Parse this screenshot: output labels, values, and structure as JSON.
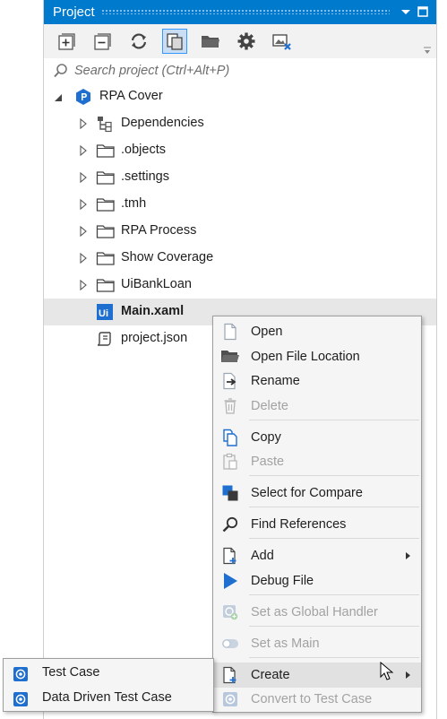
{
  "panel": {
    "title": "Project",
    "accent": "#007acc",
    "controls": [
      "chevron-down-icon",
      "restore-icon"
    ]
  },
  "toolbar": {
    "buttons": [
      {
        "name": "expand-all-icon"
      },
      {
        "name": "collapse-all-icon"
      },
      {
        "name": "refresh-icon"
      },
      {
        "name": "show-all-files-icon",
        "active": true
      },
      {
        "name": "open-folder-icon"
      },
      {
        "name": "settings-icon"
      },
      {
        "name": "remove-unused-icon"
      }
    ]
  },
  "search": {
    "placeholder": "Search project (Ctrl+Alt+P)",
    "value": ""
  },
  "tree": {
    "root": {
      "label": "RPA Cover",
      "icon": "project-icon",
      "expanded": true
    },
    "children": [
      {
        "label": "Dependencies",
        "icon": "dependencies-icon",
        "expandable": true
      },
      {
        "label": ".objects",
        "icon": "folder-icon",
        "expandable": true
      },
      {
        "label": ".settings",
        "icon": "folder-icon",
        "expandable": true
      },
      {
        "label": ".tmh",
        "icon": "folder-icon",
        "expandable": true
      },
      {
        "label": "RPA Process",
        "icon": "folder-icon",
        "expandable": true
      },
      {
        "label": "Show Coverage",
        "icon": "folder-icon",
        "expandable": true
      },
      {
        "label": "UiBankLoan",
        "icon": "folder-icon",
        "expandable": true
      },
      {
        "label": "Main.xaml",
        "icon": "xaml-file-icon",
        "selected": true
      },
      {
        "label": "project.json",
        "icon": "json-file-icon"
      }
    ]
  },
  "context_menu": {
    "items": [
      {
        "label": "Open",
        "icon": "file-icon"
      },
      {
        "label": "Open File Location",
        "icon": "folder-open-icon"
      },
      {
        "label": "Rename",
        "icon": "rename-icon"
      },
      {
        "label": "Delete",
        "icon": "trash-icon",
        "disabled": true
      },
      {
        "label": "Copy",
        "icon": "copy-icon"
      },
      {
        "label": "Paste",
        "icon": "paste-icon",
        "disabled": true
      },
      {
        "label": "Select for Compare",
        "icon": "compare-icon"
      },
      {
        "label": "Find References",
        "icon": "search-icon"
      },
      {
        "label": "Add",
        "icon": "add-file-icon",
        "submenu": true
      },
      {
        "label": "Debug File",
        "icon": "play-icon"
      },
      {
        "label": "Set as Global Handler",
        "icon": "global-handler-icon",
        "disabled": true
      },
      {
        "label": "Set as Main",
        "icon": "toggle-icon",
        "disabled": true
      },
      {
        "label": "Create",
        "icon": "create-file-icon",
        "submenu": true,
        "highlighted": true
      },
      {
        "label": "Convert to Test Case",
        "icon": "test-case-icon",
        "disabled": true
      }
    ]
  },
  "submenu": {
    "items": [
      {
        "label": "Test Case",
        "icon": "test-case-icon"
      },
      {
        "label": "Data Driven Test Case",
        "icon": "test-case-icon"
      }
    ]
  },
  "colors": {
    "title_bar": "#007acc",
    "selection": "#e7e7e7",
    "menu_bg": "#f5f5f5",
    "icon_blue": "#1e6fd0",
    "disabled_text": "#a2a2a2"
  }
}
